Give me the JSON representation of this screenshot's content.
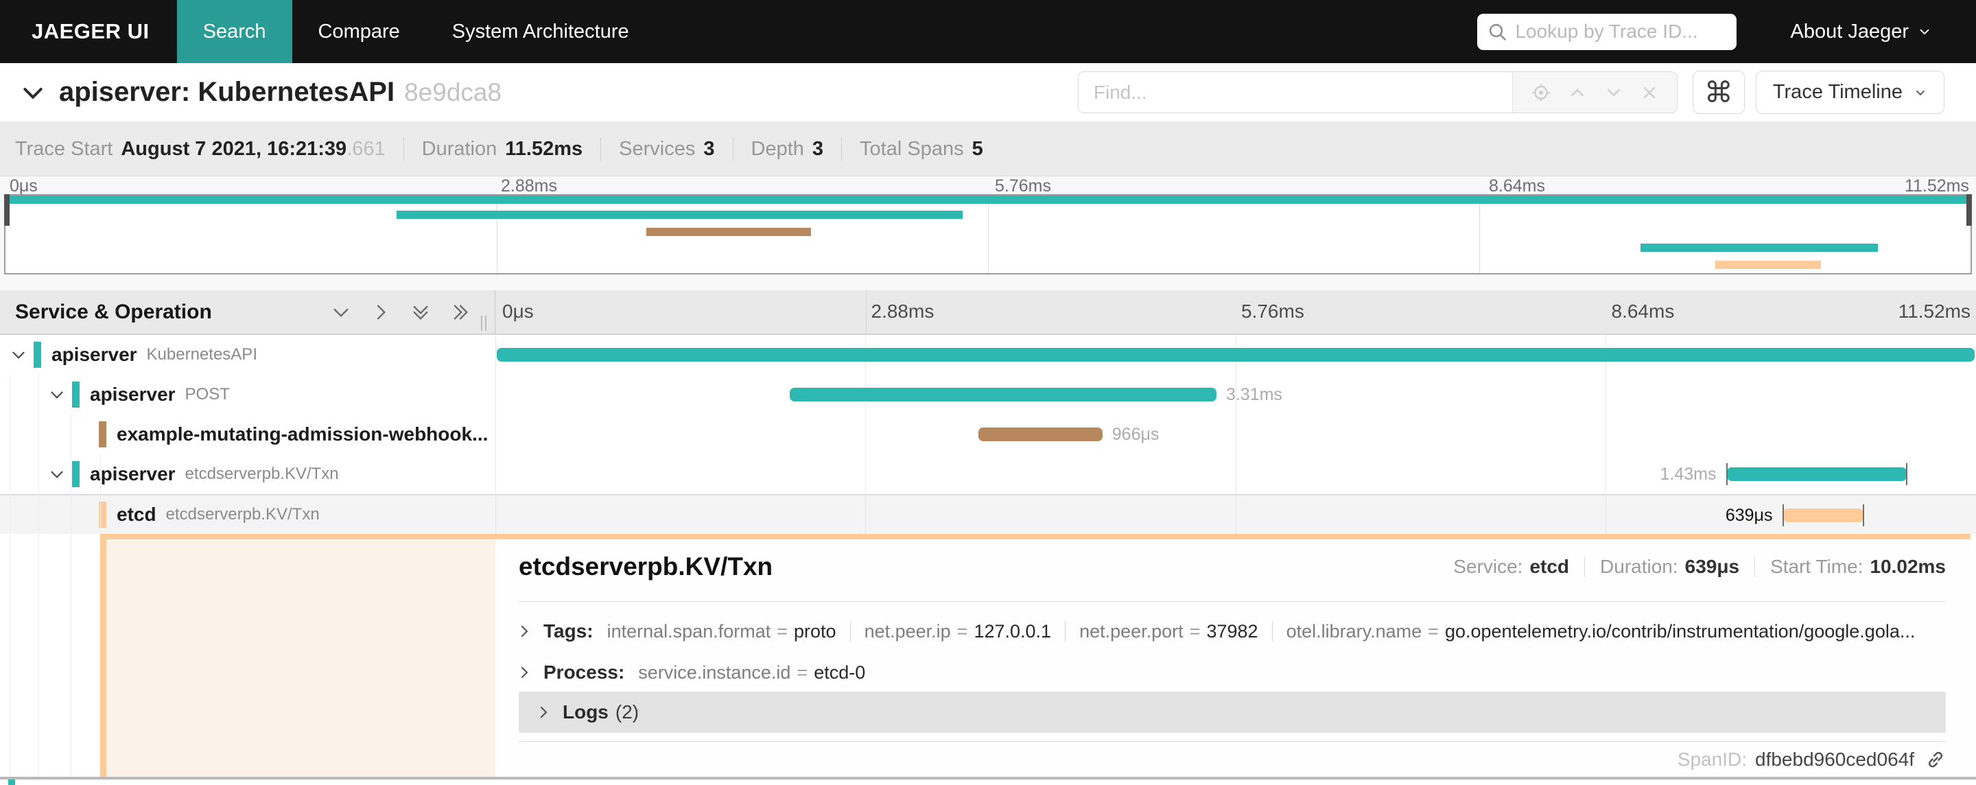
{
  "nav": {
    "brand": "JAEGER UI",
    "tabs": [
      {
        "label": "Search"
      },
      {
        "label": "Compare"
      },
      {
        "label": "System Architecture"
      }
    ],
    "lookup_placeholder": "Lookup by Trace ID...",
    "about_label": "About Jaeger"
  },
  "trace_header": {
    "title": "apiserver: KubernetesAPI",
    "trace_id_short": "8e9dca8",
    "find_placeholder": "Find...",
    "keyboard_shortcut_glyph": "⌘",
    "view_selector_label": "Trace Timeline"
  },
  "summary": {
    "trace_start_label": "Trace Start",
    "trace_start_value": "August 7 2021, 16:21:39",
    "trace_start_millis": ".661",
    "duration_label": "Duration",
    "duration_value": "11.52ms",
    "services_label": "Services",
    "services_value": "3",
    "depth_label": "Depth",
    "depth_value": "3",
    "total_spans_label": "Total Spans",
    "total_spans_value": "5"
  },
  "timeline": {
    "header_label": "Service & Operation",
    "ticks": [
      "0μs",
      "2.88ms",
      "5.76ms",
      "8.64ms",
      "11.52ms"
    ]
  },
  "spans": [
    {
      "service": "apiserver",
      "operation": "KubernetesAPI",
      "color": "#2DB8B2",
      "left": "0.1%",
      "width": "99.8%",
      "duration": ""
    },
    {
      "service": "apiserver",
      "operation": "POST",
      "color": "#2DB8B2",
      "left": "19.9%",
      "width": "28.8%",
      "duration": "3.31ms"
    },
    {
      "service": "example-mutating-admission-webhook...",
      "operation": "",
      "color": "#B7885E",
      "left": "32.6%",
      "width": "8.4%",
      "duration": "966μs"
    },
    {
      "service": "apiserver",
      "operation": "etcdserverpb.KV/Txn",
      "color": "#2DB8B2",
      "left": "83.2%",
      "width": "12.1%",
      "duration": "1.43ms"
    },
    {
      "service": "etcd",
      "operation": "etcdserverpb.KV/Txn",
      "color": "#FFCB99",
      "left": "87.0%",
      "width": "5.4%",
      "duration": "639μs"
    }
  ],
  "detail": {
    "title": "etcdserverpb.KV/Txn",
    "service_label": "Service:",
    "service_value": "etcd",
    "duration_label": "Duration:",
    "duration_value": "639μs",
    "start_time_label": "Start Time:",
    "start_time_value": "10.02ms",
    "tags_label": "Tags:",
    "equals_sign": "=",
    "tags": [
      {
        "key": "internal.span.format",
        "value": "proto"
      },
      {
        "key": "net.peer.ip",
        "value": "127.0.0.1"
      },
      {
        "key": "net.peer.port",
        "value": "37982"
      },
      {
        "key": "otel.library.name",
        "value": "go.opentelemetry.io/contrib/instrumentation/google.gola..."
      }
    ],
    "process_label": "Process:",
    "process_key": "service.instance.id",
    "process_value": "etcd-0",
    "logs_label": "Logs",
    "logs_count": "(2)",
    "spanid_label": "SpanID:",
    "spanid_value": "dfbebd960ced064f"
  }
}
